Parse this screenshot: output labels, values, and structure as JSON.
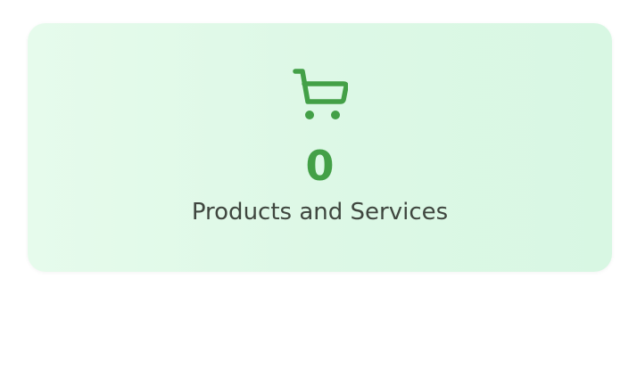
{
  "card": {
    "icon": "shopping-cart-icon",
    "value": "0",
    "label": "Products and Services"
  },
  "colors": {
    "accent": "#43a047",
    "label": "#3f463f",
    "card_bg": "#ddf8e6"
  }
}
